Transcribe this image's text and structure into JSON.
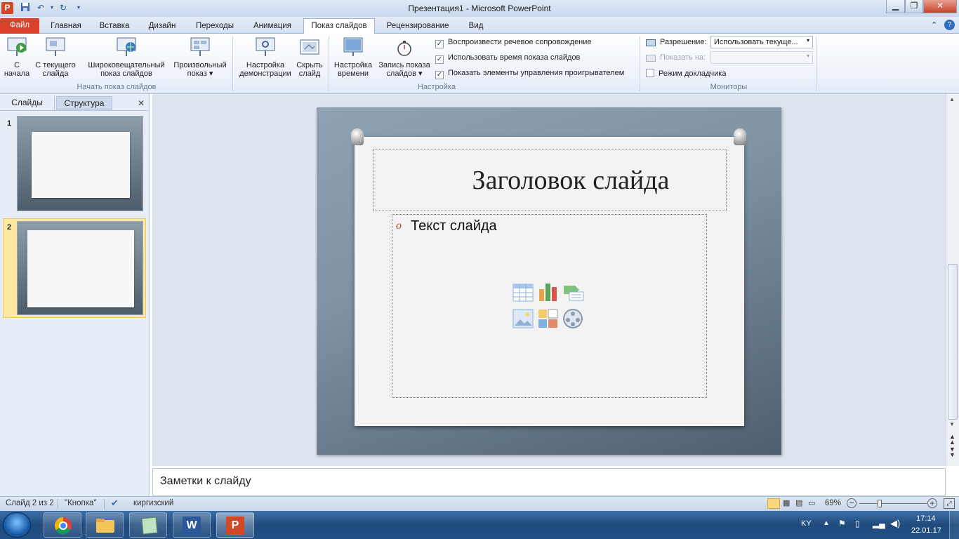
{
  "window": {
    "title": "Презентация1  -  Microsoft PowerPoint",
    "app_icon": "powerpoint-icon",
    "controls": [
      "minimize-icon",
      "maximize-icon",
      "close-icon"
    ]
  },
  "quick_access": [
    "save-icon",
    "undo-icon",
    "redo-icon",
    "customize-icon"
  ],
  "tabs": {
    "file": "Файл",
    "home": "Главная",
    "insert": "Вставка",
    "design": "Дизайн",
    "transitions": "Переходы",
    "animation": "Анимация",
    "slideshow": "Показ слайдов",
    "review": "Рецензирование",
    "view": "Вид",
    "active": "Показ слайдов"
  },
  "ribbon": {
    "start_group": {
      "label": "Начать показ слайдов",
      "from_start_1": "С",
      "from_start_2": "начала",
      "from_current_1": "С текущего",
      "from_current_2": "слайда",
      "broadcast_1": "Широковещательный",
      "broadcast_2": "показ слайдов",
      "custom_1": "Произвольный",
      "custom_2": "показ ▾"
    },
    "setup_group": {
      "label": "Настройка",
      "setup_show_1": "Настройка",
      "setup_show_2": "демонстрации",
      "hide_slide_1": "Скрыть",
      "hide_slide_2": "слайд",
      "rehearse_1": "Настройка",
      "rehearse_2": "времени",
      "record_1": "Запись показа",
      "record_2": "слайдов ▾",
      "check_narration": "Воспроизвести речевое сопровождение",
      "check_timings": "Использовать время показа слайдов",
      "check_media_controls": "Показать элементы управления проигрывателем"
    },
    "monitors_group": {
      "label": "Мониторы",
      "resolution_label": "Разрешение:",
      "resolution_value": "Использовать текуще...",
      "show_on_label": "Показать на:",
      "show_on_value": "",
      "presenter_view": "Режим докладчика"
    }
  },
  "left_panel": {
    "tab_slides": "Слайды",
    "tab_outline": "Структура",
    "close_icon": "close-icon",
    "slides": [
      {
        "number": "1"
      },
      {
        "number": "2"
      }
    ],
    "selected": "2"
  },
  "slide": {
    "title": "Заголовок слайда",
    "body_text": "Текст слайда",
    "bullet": "o",
    "content_icons": [
      "table-icon",
      "chart-icon",
      "smartart-icon",
      "picture-icon",
      "clipart-icon",
      "media-icon"
    ]
  },
  "notes": {
    "placeholder": "Заметки к слайду"
  },
  "status": {
    "slide_count": "Слайд 2 из 2",
    "theme": "\"Кнопка\"",
    "language": "киргизский",
    "zoom": "69%"
  },
  "taskbar": {
    "apps": [
      "start-icon",
      "chrome-icon",
      "explorer-icon",
      "notepad-icon",
      "word-icon",
      "powerpoint-icon"
    ],
    "language": "KY",
    "time": "17:14",
    "date": "22.01.17"
  }
}
